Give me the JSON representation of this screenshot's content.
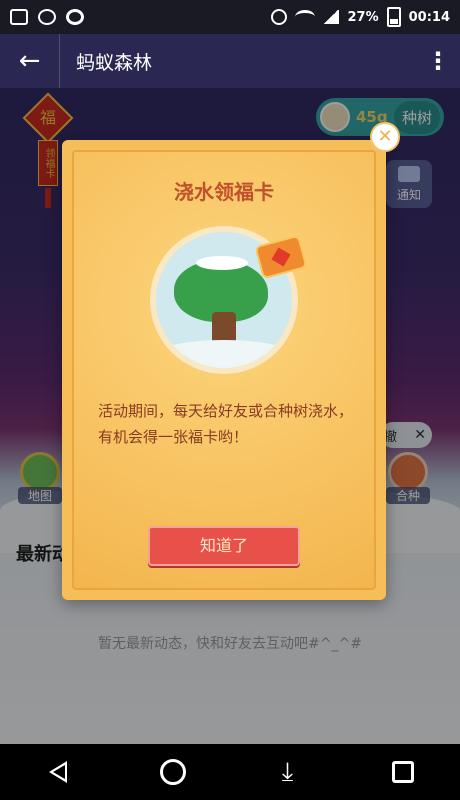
{
  "status_bar": {
    "battery": "27%",
    "time": "00:14"
  },
  "title_bar": {
    "back_icon": "←",
    "title": "蚂蚁森林",
    "menu_icon": "⋮"
  },
  "forest": {
    "fu_char": "福",
    "fuka_label": "领福卡",
    "energy_value": "45g",
    "plant_label": "种树",
    "notify_label": "通知",
    "map_label": "地图",
    "co_plant_label": "合种",
    "toast_text": "撤",
    "toast_close": "✕",
    "latest_title": "最新动态",
    "empty_text": "暂无最新动态，快和好友去互动吧#^_^#"
  },
  "modal": {
    "title": "浇水领福卡",
    "body": "活动期间，每天给好友或合种树浇水，有机会得一张福卡哟！",
    "button_label": "知道了",
    "close_icon": "✕"
  },
  "nav_bar": {
    "icons": [
      "back-icon",
      "home-icon",
      "download-icon",
      "recent-apps-icon"
    ]
  },
  "colors": {
    "modal_bg": "#f6be58",
    "modal_title": "#c0512a",
    "button_bg": "#e8504a",
    "title_bar_bg": "#2a2752",
    "energy_pill": "#38a6a6"
  }
}
